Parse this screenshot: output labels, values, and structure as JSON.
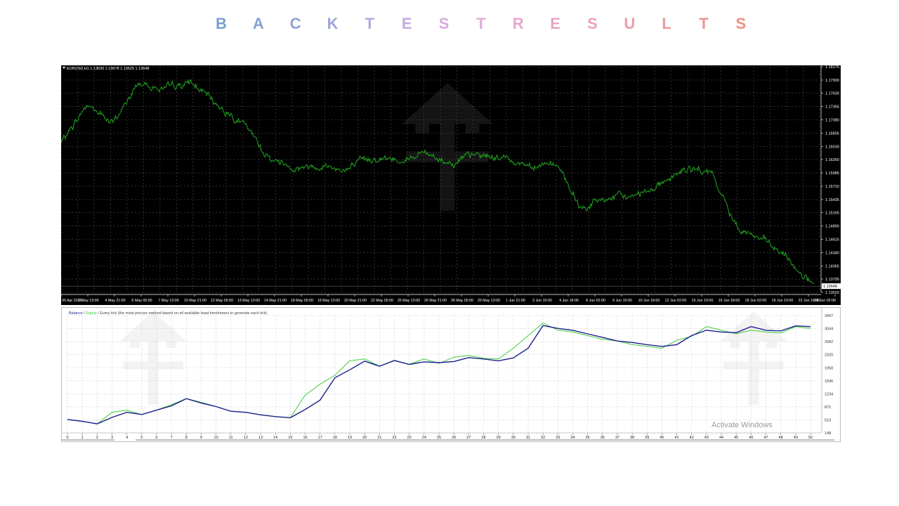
{
  "title": {
    "letters": [
      "B",
      "A",
      "C",
      "K",
      "T",
      "E",
      "S",
      "T",
      "R",
      "E",
      "S",
      "U",
      "L",
      "T",
      "S"
    ],
    "colors": [
      "#7a9fcf",
      "#84a0d3",
      "#91a2d8",
      "#a1a4db",
      "#b3a7de",
      "#c5a9df",
      "#d7aadd",
      "#e1aad8",
      "#e6a8cf",
      "#e9a5c4",
      "#eba2b6",
      "#ec9eaa",
      "#ed9a9d",
      "#ee9592",
      "#ef8f86"
    ]
  },
  "colors": {
    "price_line": "#1f9a1f",
    "price_bg": "#000000",
    "grid_dark": "#4f4f4f",
    "balance": "#1b1f8c",
    "equity": "#3fcc3f"
  },
  "price_chart": {
    "header": "EURUSD,H1  1.13630 1.13678 1.13625 1.13648",
    "y_ticks": [
      "1.18175",
      "1.17900",
      "1.17630",
      "1.17355",
      "1.17080",
      "1.16805",
      "1.16530",
      "1.16260",
      "1.15985",
      "1.15710",
      "1.15435",
      "1.15165",
      "1.14890",
      "1.14615",
      "1.14340",
      "1.14065",
      "1.13795",
      "1.13520"
    ],
    "current_price": "1.13648",
    "x_ticks": [
      "30 Apr 2026",
      "1 May 13:00",
      "4 May 21:00",
      "6 May 05:00",
      "7 May 13:00",
      "10 May 21:00",
      "12 May 05:00",
      "13 May 13:00",
      "14 May 21:00",
      "18 May 05:00",
      "19 May 13:00",
      "20 May 21:00",
      "22 May 05:00",
      "25 May 13:00",
      "26 May 21:00",
      "28 May 05:00",
      "29 May 13:00",
      "1 Jun 21:00",
      "3 Jun 10:00",
      "4 Jun 18:00",
      "8 Jun 02:00",
      "9 Jun 10:00",
      "10 Jun 18:00",
      "12 Jun 02:00",
      "15 Jun 10:00",
      "16 Jun 18:00",
      "18 Jun 02:00",
      "19 Jun 10:00",
      "22 Jun 18:00",
      "24 Jun 02:00"
    ]
  },
  "equity_chart": {
    "legend_balance": "Balance",
    "legend_sep1": " / ",
    "legend_equity": "Equity",
    "legend_rest": " / Every tick (the most precise method based on all available least timeframes to generate each tick)"
  },
  "watermark_text": "Activate Windows",
  "chart_data": [
    {
      "type": "line",
      "title": "",
      "symbol": "EURUSD,H1",
      "ylim": [
        1.1352,
        1.18175
      ],
      "series": [
        {
          "name": "EURUSD",
          "x": [
            "30 Apr 2026",
            "1 May 13:00",
            "4 May 21:00",
            "6 May 05:00",
            "7 May 13:00",
            "10 May 21:00",
            "12 May 05:00",
            "13 May 13:00",
            "14 May 21:00",
            "18 May 05:00",
            "19 May 13:00",
            "20 May 21:00",
            "22 May 05:00",
            "25 May 13:00",
            "26 May 21:00",
            "28 May 05:00",
            "29 May 13:00",
            "1 Jun 21:00",
            "3 Jun 10:00",
            "4 Jun 18:00",
            "8 Jun 02:00",
            "9 Jun 10:00",
            "10 Jun 18:00",
            "12 Jun 02:00",
            "15 Jun 10:00",
            "16 Jun 18:00",
            "18 Jun 02:00",
            "19 Jun 10:00",
            "22 Jun 18:00",
            "24 Jun 02:00"
          ],
          "values": [
            1.166,
            1.174,
            1.17,
            1.1785,
            1.177,
            1.1785,
            1.174,
            1.17,
            1.163,
            1.161,
            1.1615,
            1.1605,
            1.163,
            1.1625,
            1.164,
            1.162,
            1.1635,
            1.163,
            1.1615,
            1.162,
            1.1525,
            1.1545,
            1.155,
            1.1575,
            1.1605,
            1.16,
            1.149,
            1.146,
            1.142,
            1.1365
          ]
        }
      ],
      "grid": true
    },
    {
      "type": "line",
      "title": "",
      "x": [
        0,
        1,
        2,
        3,
        4,
        5,
        6,
        7,
        8,
        9,
        10,
        11,
        12,
        13,
        14,
        15,
        16,
        17,
        18,
        19,
        20,
        21,
        22,
        23,
        24,
        25,
        26,
        27,
        28,
        29,
        30,
        31,
        32,
        33,
        34,
        35,
        36,
        37,
        38,
        39,
        40,
        41,
        42,
        43,
        44,
        45,
        46,
        47,
        48,
        49,
        50
      ],
      "ylim": [
        148,
        3407
      ],
      "y_ticks": [
        "3407",
        "3044",
        "2682",
        "2320",
        "1958",
        "1596",
        "1234",
        "872",
        "510",
        "148"
      ],
      "series": [
        {
          "name": "Balance",
          "values": [
            520,
            470,
            400,
            580,
            720,
            660,
            780,
            900,
            1100,
            980,
            880,
            750,
            720,
            650,
            600,
            570,
            800,
            1060,
            1680,
            1900,
            2140,
            2000,
            2160,
            2050,
            2120,
            2100,
            2130,
            2240,
            2200,
            2150,
            2230,
            2500,
            3130,
            3050,
            3000,
            2900,
            2800,
            2700,
            2660,
            2600,
            2550,
            2600,
            2850,
            3000,
            2950,
            2930,
            3100,
            3000,
            2980,
            3120,
            3100
          ]
        },
        {
          "name": "Equity",
          "values": [
            520,
            470,
            400,
            720,
            780,
            660,
            780,
            930,
            1100,
            1000,
            880,
            750,
            720,
            650,
            600,
            570,
            1200,
            1500,
            1750,
            2150,
            2200,
            2000,
            2150,
            2050,
            2200,
            2080,
            2250,
            2300,
            2220,
            2200,
            2500,
            2850,
            3200,
            3000,
            2950,
            2850,
            2750,
            2700,
            2600,
            2550,
            2500,
            2720,
            2830,
            3100,
            3000,
            2900,
            3000,
            2950,
            2920,
            3100,
            3050
          ]
        }
      ],
      "grid": true
    }
  ]
}
